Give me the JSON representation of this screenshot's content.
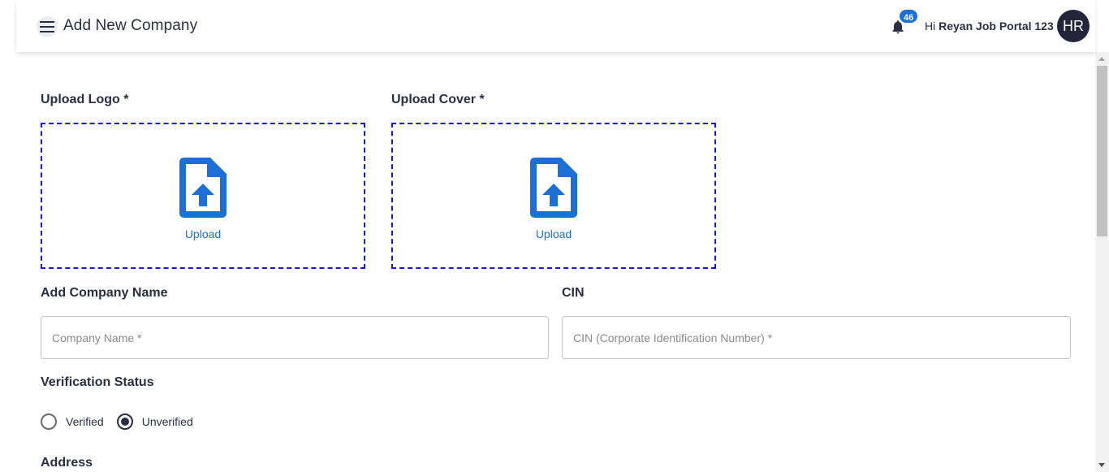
{
  "header": {
    "title": "Add New Company",
    "notification_count": "46",
    "greeting_prefix": "Hi",
    "user_name": "Reyan Job Portal 123",
    "avatar_initials": "HR"
  },
  "uploads": {
    "logo": {
      "label": "Upload Logo *",
      "button": "Upload"
    },
    "cover": {
      "label": "Upload Cover *",
      "button": "Upload"
    }
  },
  "company_name": {
    "label": "Add Company Name",
    "placeholder": "Company Name *",
    "value": ""
  },
  "cin": {
    "label": "CIN",
    "placeholder": "CIN (Corporate Identification Number) *",
    "value": ""
  },
  "verification": {
    "label": "Verification Status",
    "options": [
      {
        "label": "Verified",
        "checked": false
      },
      {
        "label": "Unverified",
        "checked": true
      }
    ]
  },
  "address": {
    "label": "Address"
  },
  "colors": {
    "accent": "#1c6fd6",
    "dashed_border": "#1515d6",
    "text": "#2b2d42",
    "avatar_bg": "#23263b"
  }
}
